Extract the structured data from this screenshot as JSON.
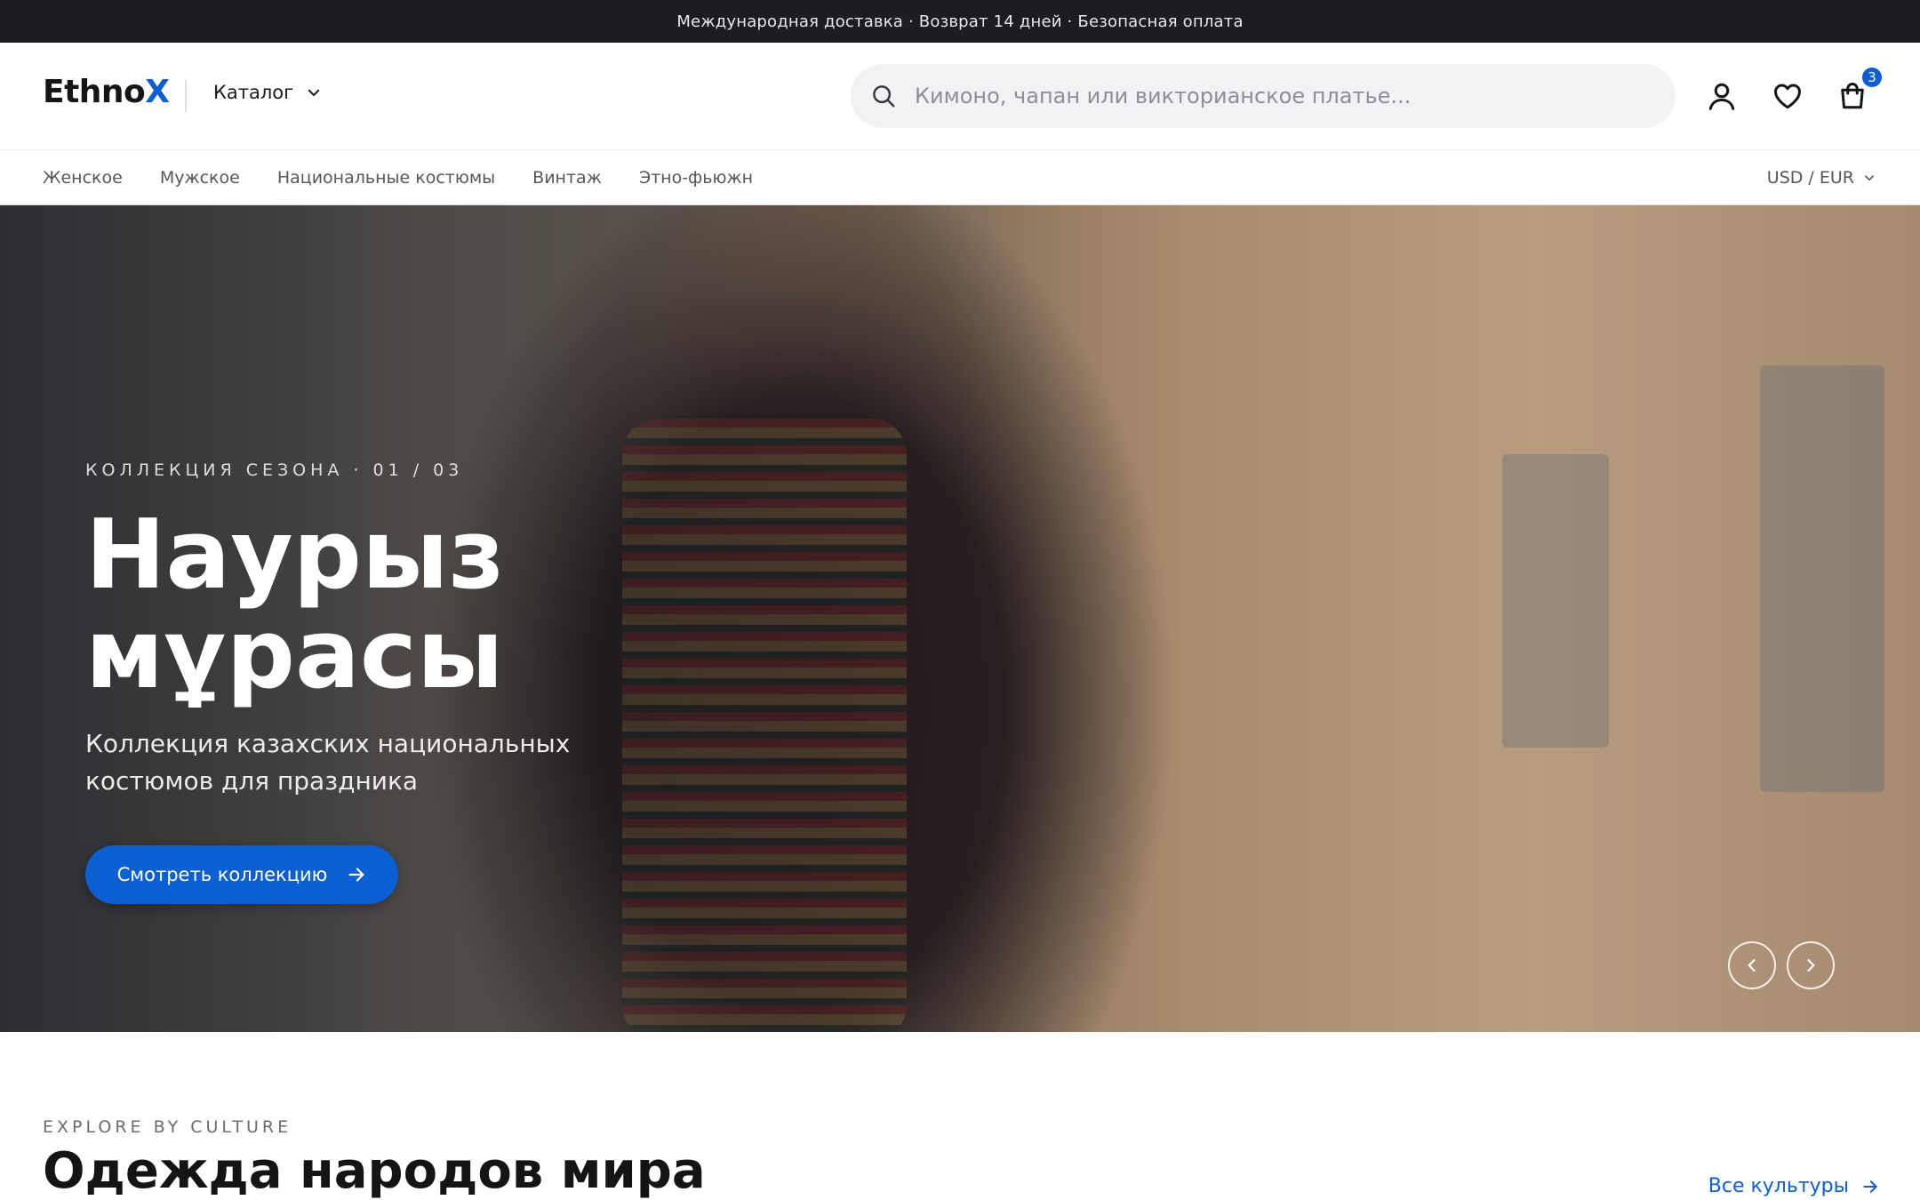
{
  "announcement": "Международная доставка · Возврат 14 дней · Безопасная оплата",
  "header": {
    "logo_main": "Ethno",
    "logo_accent": "X",
    "catalog_label": "Каталог",
    "search_placeholder": "Кимоно, чапан или викторианское платье...",
    "cart_count": "3",
    "icons": [
      "search-icon",
      "user-icon",
      "heart-icon",
      "cart-icon"
    ]
  },
  "nav": {
    "items": [
      "Женское",
      "Мужское",
      "Национальные костюмы",
      "Винтаж",
      "Этно-фьюжн"
    ],
    "currency": "USD / EUR"
  },
  "hero": {
    "eyebrow": "КОЛЛЕКЦИЯ СЕЗОНА · 01 / 03",
    "title_line1": "Наурыз",
    "title_line2": "мұрасы",
    "subtitle_line1": "Коллекция казахских национальных",
    "subtitle_line2": "костюмов для праздника",
    "cta_label": "Смотреть коллекцию"
  },
  "section": {
    "eyebrow": "EXPLORE BY CULTURE",
    "title": "Одежда народов мира",
    "link_label": "Все культуры"
  },
  "colors": {
    "accent": "#0a5fd2",
    "announce_bg": "#1c1d20"
  }
}
